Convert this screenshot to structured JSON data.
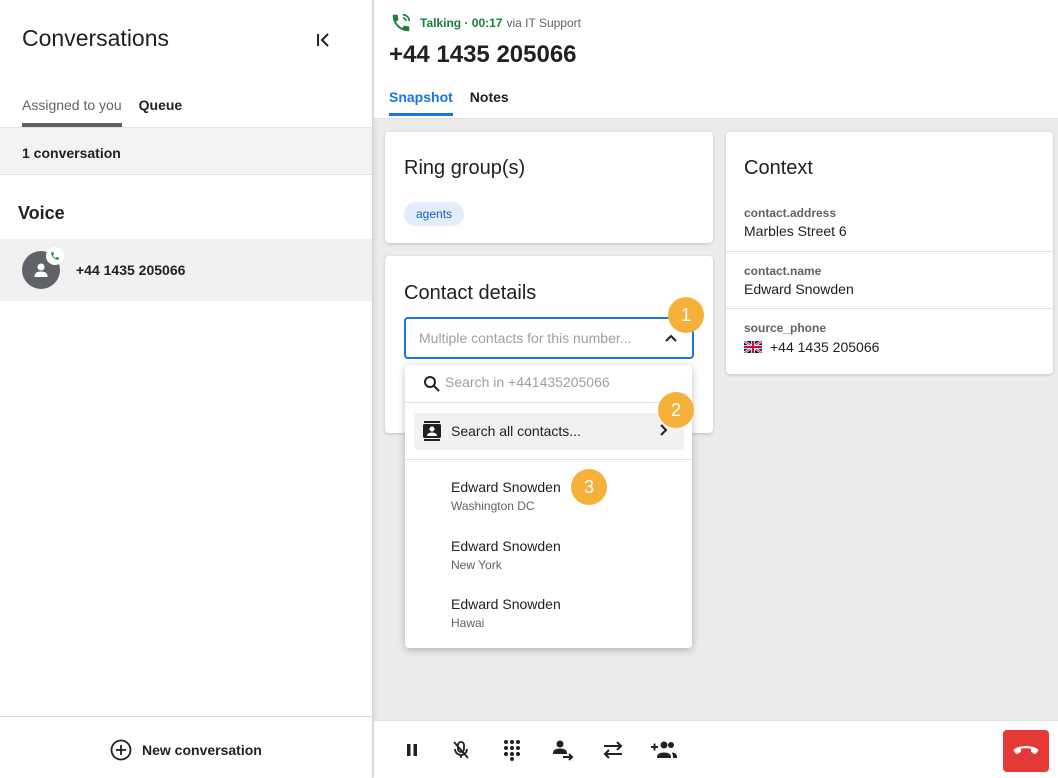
{
  "sidebar": {
    "title": "Conversations",
    "tabs": [
      {
        "label": "Assigned to you"
      },
      {
        "label": "Queue"
      }
    ],
    "conversation_count": "1 conversation",
    "section_title": "Voice",
    "conversations": [
      {
        "phone": "+44 1435 205066"
      }
    ],
    "new_conversation_label": "New conversation"
  },
  "header": {
    "status": "Talking · 00:17",
    "via": "via IT Support",
    "phone": "+44 1435 205066",
    "tabs": [
      {
        "label": "Snapshot"
      },
      {
        "label": "Notes"
      }
    ]
  },
  "ring_groups": {
    "title": "Ring group(s)",
    "chip": "agents"
  },
  "contact_details": {
    "title": "Contact details",
    "select_placeholder": "Multiple contacts for this number...",
    "dropdown": {
      "search_placeholder": "Search in +441435205066",
      "search_all_label": "Search all contacts...",
      "contacts": [
        {
          "name": "Edward Snowden",
          "city": "Washington DC"
        },
        {
          "name": "Edward Snowden",
          "city": "New York"
        },
        {
          "name": "Edward Snowden",
          "city": "Hawai"
        }
      ]
    }
  },
  "context": {
    "title": "Context",
    "fields": [
      {
        "label": "contact.address",
        "value": "Marbles Street 6"
      },
      {
        "label": "contact.name",
        "value": "Edward Snowden"
      },
      {
        "label": "source_phone",
        "value": "+44 1435 205066"
      }
    ]
  },
  "badges": [
    "1",
    "2",
    "3"
  ],
  "colors": {
    "accent": "#1a73e8",
    "talking": "#188038",
    "hangup": "#e53935",
    "badge": "#f6b13b"
  }
}
